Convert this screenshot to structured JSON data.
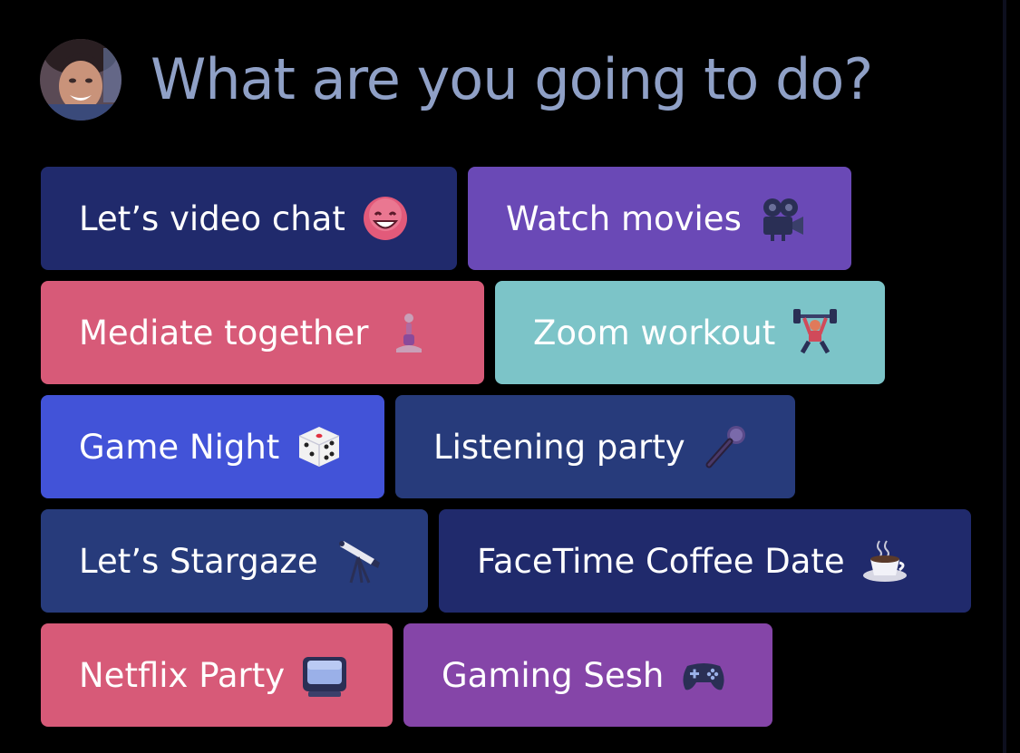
{
  "header": {
    "title": "What are you going to do?"
  },
  "colors": {
    "background": "#000000",
    "title": "#8fa0c6",
    "navy": "#202a6c",
    "purple": "#6a49b6",
    "pink": "#d75a78",
    "teal": "#7cc4c8",
    "blue": "#4253d8",
    "slate": "#273b7b",
    "violet": "#8545a8"
  },
  "options": [
    {
      "label": "Let’s video chat",
      "icon": "grinning-face-icon",
      "color": "#202a6c"
    },
    {
      "label": "Watch movies",
      "icon": "movie-camera-icon",
      "color": "#6a49b6"
    },
    {
      "label": "Mediate together",
      "icon": "person-in-lotus-position-icon",
      "color": "#d75a78"
    },
    {
      "label": "Zoom workout",
      "icon": "weight-lifter-icon",
      "color": "#7cc4c8"
    },
    {
      "label": "Game Night",
      "icon": "game-die-icon",
      "color": "#4253d8"
    },
    {
      "label": "Listening party",
      "icon": "microphone-icon",
      "color": "#273b7b"
    },
    {
      "label": "Let’s Stargaze",
      "icon": "telescope-icon",
      "color": "#273b7b"
    },
    {
      "label": "FaceTime Coffee Date",
      "icon": "hot-beverage-icon",
      "color": "#202a6c"
    },
    {
      "label": "Netflix Party",
      "icon": "television-icon",
      "color": "#d75a78"
    },
    {
      "label": "Gaming Sesh",
      "icon": "video-game-controller-icon",
      "color": "#8545a8"
    }
  ]
}
